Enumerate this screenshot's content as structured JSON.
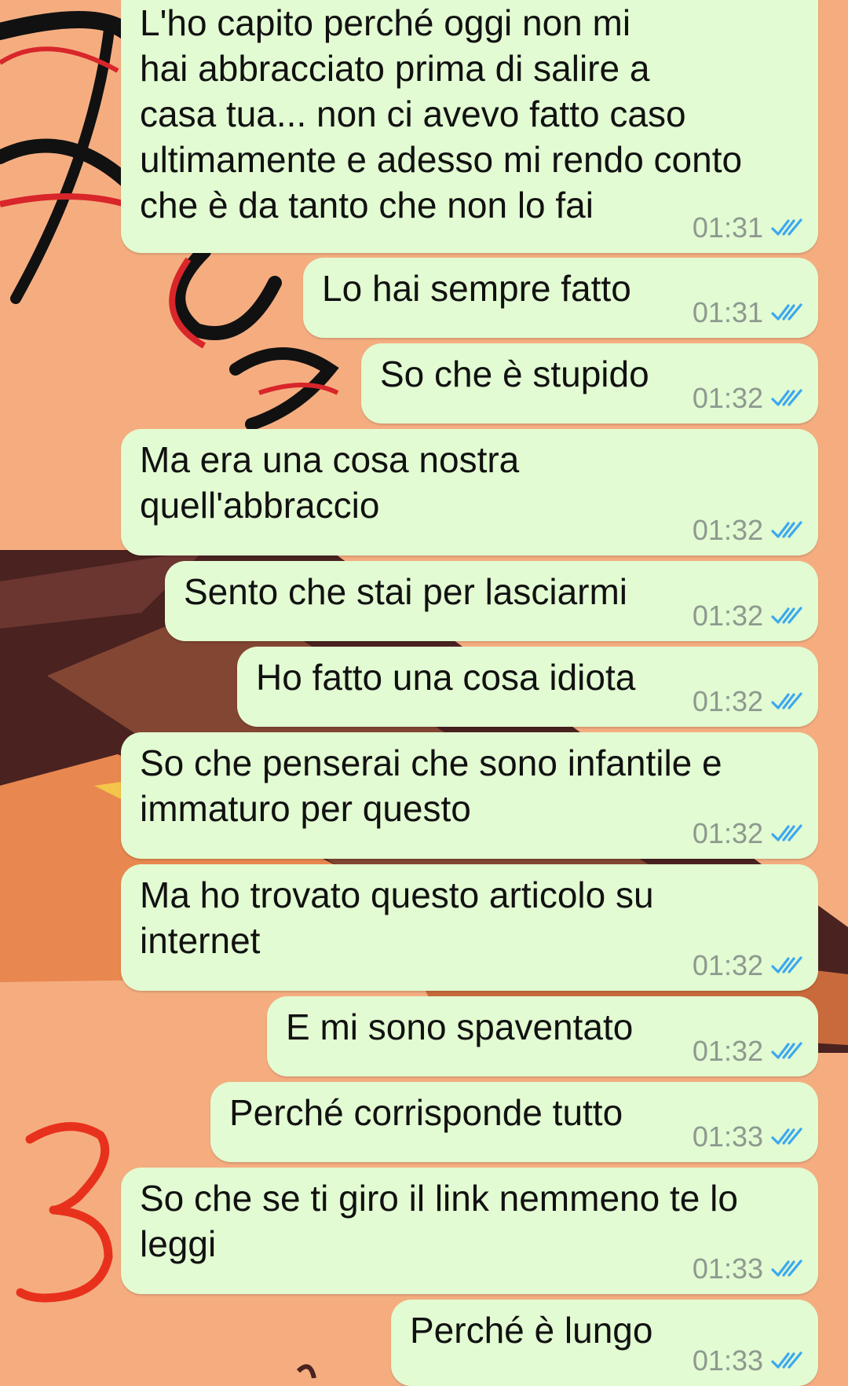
{
  "colors": {
    "wallpaper": "#f5ad80",
    "bubble_outgoing": "#e2fbd2",
    "read_ticks": "#3da8ef",
    "annotation": "#e8311c"
  },
  "annotation": {
    "number": "3"
  },
  "messages": [
    {
      "text": "L'ho capito perché oggi non mi\nhai abbracciato prima di salire a\ncasa tua... non ci avevo fatto caso\nultimamente e adesso mi rendo conto\nche è da tanto che non lo fai",
      "time": "01:31",
      "status_icon": "read-double-tick-icon"
    },
    {
      "text": "Lo hai sempre fatto",
      "time": "01:31",
      "status_icon": "read-double-tick-icon"
    },
    {
      "text": "So che è stupido",
      "time": "01:32",
      "status_icon": "read-double-tick-icon"
    },
    {
      "text": "Ma era una cosa nostra\nquell'abbraccio",
      "time": "01:32",
      "status_icon": "read-double-tick-icon"
    },
    {
      "text": "Sento che stai per lasciarmi",
      "time": "01:32",
      "status_icon": "read-double-tick-icon"
    },
    {
      "text": "Ho fatto una cosa idiota",
      "time": "01:32",
      "status_icon": "read-double-tick-icon"
    },
    {
      "text": "So che penserai che sono infantile e\nimmaturo per questo",
      "time": "01:32",
      "status_icon": "read-double-tick-icon"
    },
    {
      "text": "Ma ho trovato questo articolo su\ninternet",
      "time": "01:32",
      "status_icon": "read-double-tick-icon"
    },
    {
      "text": "E mi sono spaventato",
      "time": "01:32",
      "status_icon": "read-double-tick-icon"
    },
    {
      "text": "Perché corrisponde tutto",
      "time": "01:33",
      "status_icon": "read-double-tick-icon"
    },
    {
      "text": "So che se ti giro il link nemmeno te lo\nleggi",
      "time": "01:33",
      "status_icon": "read-double-tick-icon"
    },
    {
      "text": "Perché è lungo",
      "time": "01:33",
      "status_icon": "read-double-tick-icon"
    }
  ]
}
